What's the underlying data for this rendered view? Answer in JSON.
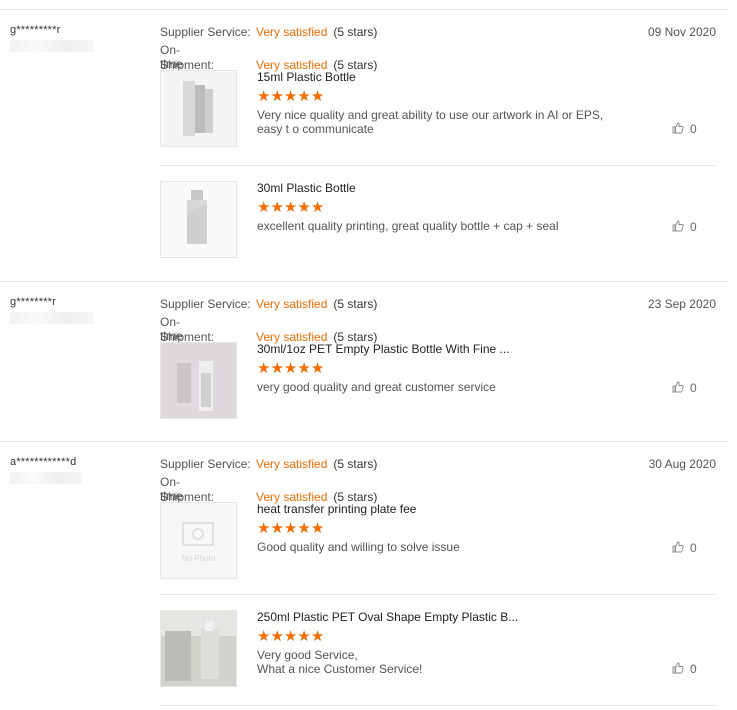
{
  "labels": {
    "supplier_service": "Supplier Service:",
    "ontime_line1": "On-time",
    "ontime_line2": "Shipment:"
  },
  "reviews": [
    {
      "reviewer": "g*********r",
      "supplier_service": "Very satisfied",
      "supplier_service_stars": "(5 stars)",
      "ontime_shipment": "Very satisfied",
      "ontime_shipment_stars": "(5 stars)",
      "date": "09 Nov 2020",
      "items": [
        {
          "title": "15ml Plastic Bottle",
          "rating": 5,
          "comment": "Very nice quality and great ability to use our artwork in AI or EPS, easy t o communicate",
          "likes": "0"
        },
        {
          "title": "30ml Plastic Bottle",
          "rating": 5,
          "comment": "excellent quality printing, great quality bottle + cap + seal",
          "likes": "0"
        }
      ]
    },
    {
      "reviewer": "g********r",
      "supplier_service": "Very satisfied",
      "supplier_service_stars": "(5 stars)",
      "ontime_shipment": "Very satisfied",
      "ontime_shipment_stars": "(5 stars)",
      "date": "23 Sep 2020",
      "items": [
        {
          "title": "30ml/1oz PET Empty Plastic Bottle With Fine ...",
          "rating": 5,
          "comment": "very good quality and great customer service",
          "likes": "0"
        }
      ]
    },
    {
      "reviewer": "a************d",
      "supplier_service": "Very satisfied",
      "supplier_service_stars": "(5 stars)",
      "ontime_shipment": "Very satisfied",
      "ontime_shipment_stars": "(5 stars)",
      "date": "30 Aug 2020",
      "items": [
        {
          "title": "heat transfer printing plate fee",
          "rating": 5,
          "comment": "Good quality and willing to solve issue",
          "likes": "0",
          "thumb_text": "No Photo"
        },
        {
          "title": "250ml Plastic PET Oval Shape Empty Plastic B...",
          "rating": 5,
          "comment": "Very good Service,\nWhat a nice Customer Service!",
          "likes": "0"
        }
      ]
    }
  ],
  "icons": {
    "star": "star-icon",
    "like": "thumbs-up-icon"
  },
  "colors": {
    "accent": "#f36c00",
    "divider": "#e4e4e4"
  }
}
